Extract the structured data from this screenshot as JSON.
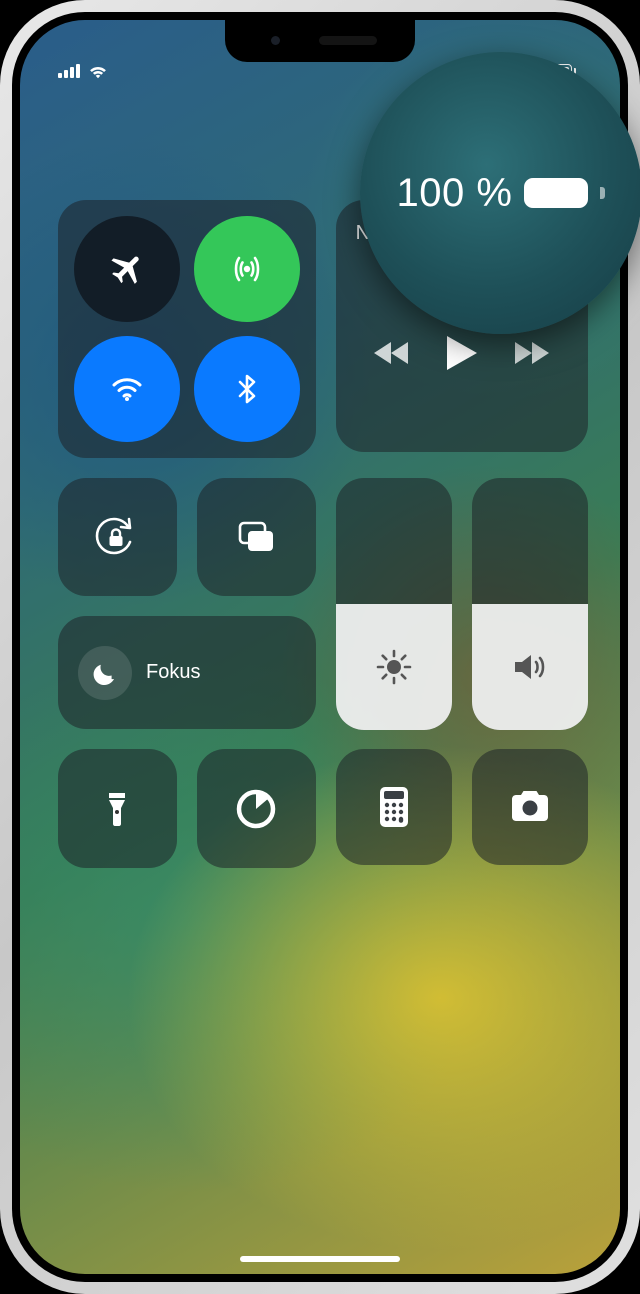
{
  "status": {
    "battery_percent_text": "100%",
    "signal_bars": 4,
    "wifi_on": true,
    "battery_percent": 100
  },
  "zoom": {
    "battery_percent_text": "100 %"
  },
  "connectivity": {
    "airplane_label": "Airplane Mode",
    "cellular_label": "Cellular Data",
    "wifi_label": "Wi-Fi",
    "bluetooth_label": "Bluetooth"
  },
  "media": {
    "title": "Ne reproduzca"
  },
  "focus": {
    "label": "Fokus"
  },
  "sliders": {
    "brightness_level": 50,
    "volume_level": 50
  },
  "shortcuts": {
    "orientation_lock": "Rotation Lock",
    "screen_mirroring": "Screen Mirroring",
    "flashlight": "Flashlight",
    "timer": "Timer",
    "calculator": "Calculator",
    "camera": "Camera"
  },
  "colors": {
    "toggle_blue": "#0a7aff",
    "toggle_green": "#34c759",
    "module_bg": "rgba(30,35,40,0.55)"
  }
}
